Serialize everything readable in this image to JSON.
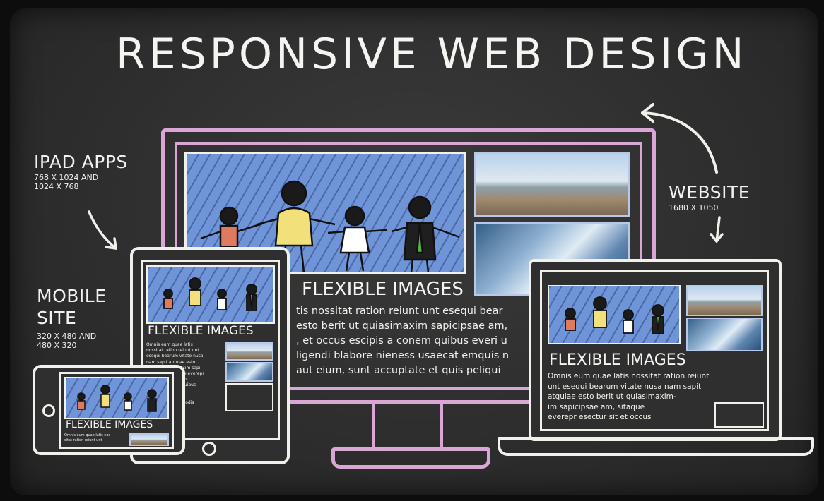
{
  "title": "RESPONSIVE WEB DESIGN",
  "labels": {
    "ipad": {
      "name": "IPAD APPS",
      "res_line1": "768 X 1024 AND",
      "res_line2": "1024 X 768"
    },
    "mobile": {
      "name_line1": "MOBILE",
      "name_line2": "SITE",
      "res_line1": "320 X 480 AND",
      "res_line2": "480 X 320"
    },
    "website": {
      "name": "WEBSITE",
      "res": "1680 X 1050"
    }
  },
  "monitor": {
    "heading": "FLEXIBLE IMAGES",
    "lines": [
      "tis nossitat ration reiunt unt esequi bear",
      "esto berit ut quiasimaxim sapicipsae am,",
      ", et occus escipis a conem quibus everi u",
      "ligendi blabore nieness usaecat emquis n",
      "aut eium, sunt accuptate et quis peliqui"
    ]
  },
  "tablet": {
    "heading": "FLEXIBLE IMAGES",
    "lines": [
      "Omnis eum quae latis",
      "nossitat ration reiunt unt",
      "esequi bearum vitate nusa",
      "nam sapit atquiae esto",
      "berit ut quiasimaxim sapi-",
      "cipsae am, sitaque everepr",
      "esectur sit et occus",
      "escipis a conem quibus",
      "everi ut alignedi",
      "blabore nieness",
      "usaecat emquis modis"
    ]
  },
  "laptop": {
    "heading": "FLEXIBLE IMAGES",
    "lines": [
      "Omnis eum quae latis nossitat ration reiunt",
      "unt esequi bearum vitate nusa nam sapit",
      "atquiae esto berit ut quiasimaxim-",
      "im sapicipsae am, sitaque",
      "everepr esectur sit et occus"
    ]
  },
  "phone": {
    "heading": "FLEXIBLE IMAGES",
    "lines": [
      "Omnis eum quae latis nos-",
      "sitat ration reiunt unt"
    ]
  },
  "colors": {
    "board": "#2e2e2e",
    "chalk": "#f2f2ee",
    "monitor_pink": "#d9a6d6",
    "hero_blue": "#6f94d8"
  },
  "icons": [
    "arrow-curved-icon",
    "arrow-down-icon"
  ]
}
